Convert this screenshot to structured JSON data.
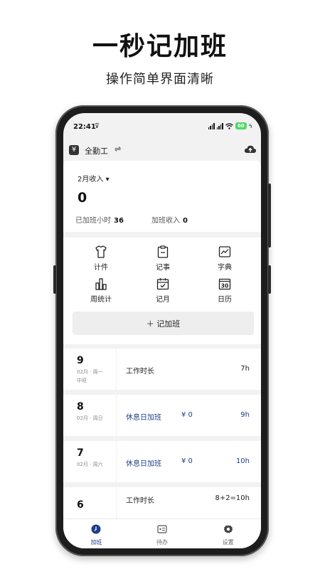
{
  "promo": {
    "headline": "一秒记加班",
    "subline": "操作简单界面清晰"
  },
  "status_bar": {
    "time": "22:41",
    "battery": "60"
  },
  "app_bar": {
    "mode_label": "全勤工",
    "mode_icon_glyph": "¥"
  },
  "income": {
    "month_label": "2月收入",
    "value": "0",
    "overtime_hours_label": "已加班小时",
    "overtime_hours_value": "36",
    "overtime_income_label": "加班收入",
    "overtime_income_value": "0"
  },
  "tools": [
    {
      "label": "计件",
      "icon": "shirt-icon"
    },
    {
      "label": "记事",
      "icon": "clipboard-icon"
    },
    {
      "label": "字典",
      "icon": "chart-icon"
    },
    {
      "label": "周统计",
      "icon": "bar-chart-icon"
    },
    {
      "label": "记月",
      "icon": "calendar-check-icon"
    },
    {
      "label": "日历",
      "icon": "calendar-30-icon"
    }
  ],
  "calendar_icon_text": "30",
  "add_button": {
    "label": "记加班"
  },
  "days": [
    {
      "day": "9",
      "sub": "02月 · 周一",
      "extra": "中班",
      "type": "工作时长",
      "money": "",
      "hours": "7h",
      "accent": false
    },
    {
      "day": "8",
      "sub": "02月 · 周日",
      "extra": "",
      "type": "休息日加班",
      "money": "¥ 0",
      "hours": "9h",
      "accent": true
    },
    {
      "day": "7",
      "sub": "02月 · 周六",
      "extra": "",
      "type": "休息日加班",
      "money": "¥ 0",
      "hours": "10h",
      "accent": true
    },
    {
      "day": "6",
      "sub": "",
      "extra": "",
      "type": "工作时长",
      "money": "",
      "hours": "8+2=10h",
      "accent": false
    }
  ],
  "bottom_nav": [
    {
      "label": "加班",
      "icon": "clock-icon",
      "active": true
    },
    {
      "label": "待办",
      "icon": "todo-icon",
      "active": false
    },
    {
      "label": "设置",
      "icon": "gear-icon",
      "active": false
    }
  ],
  "colors": {
    "accent": "#1f3f8a",
    "screen_bg": "#f2f2f2",
    "battery": "#4cd964"
  }
}
